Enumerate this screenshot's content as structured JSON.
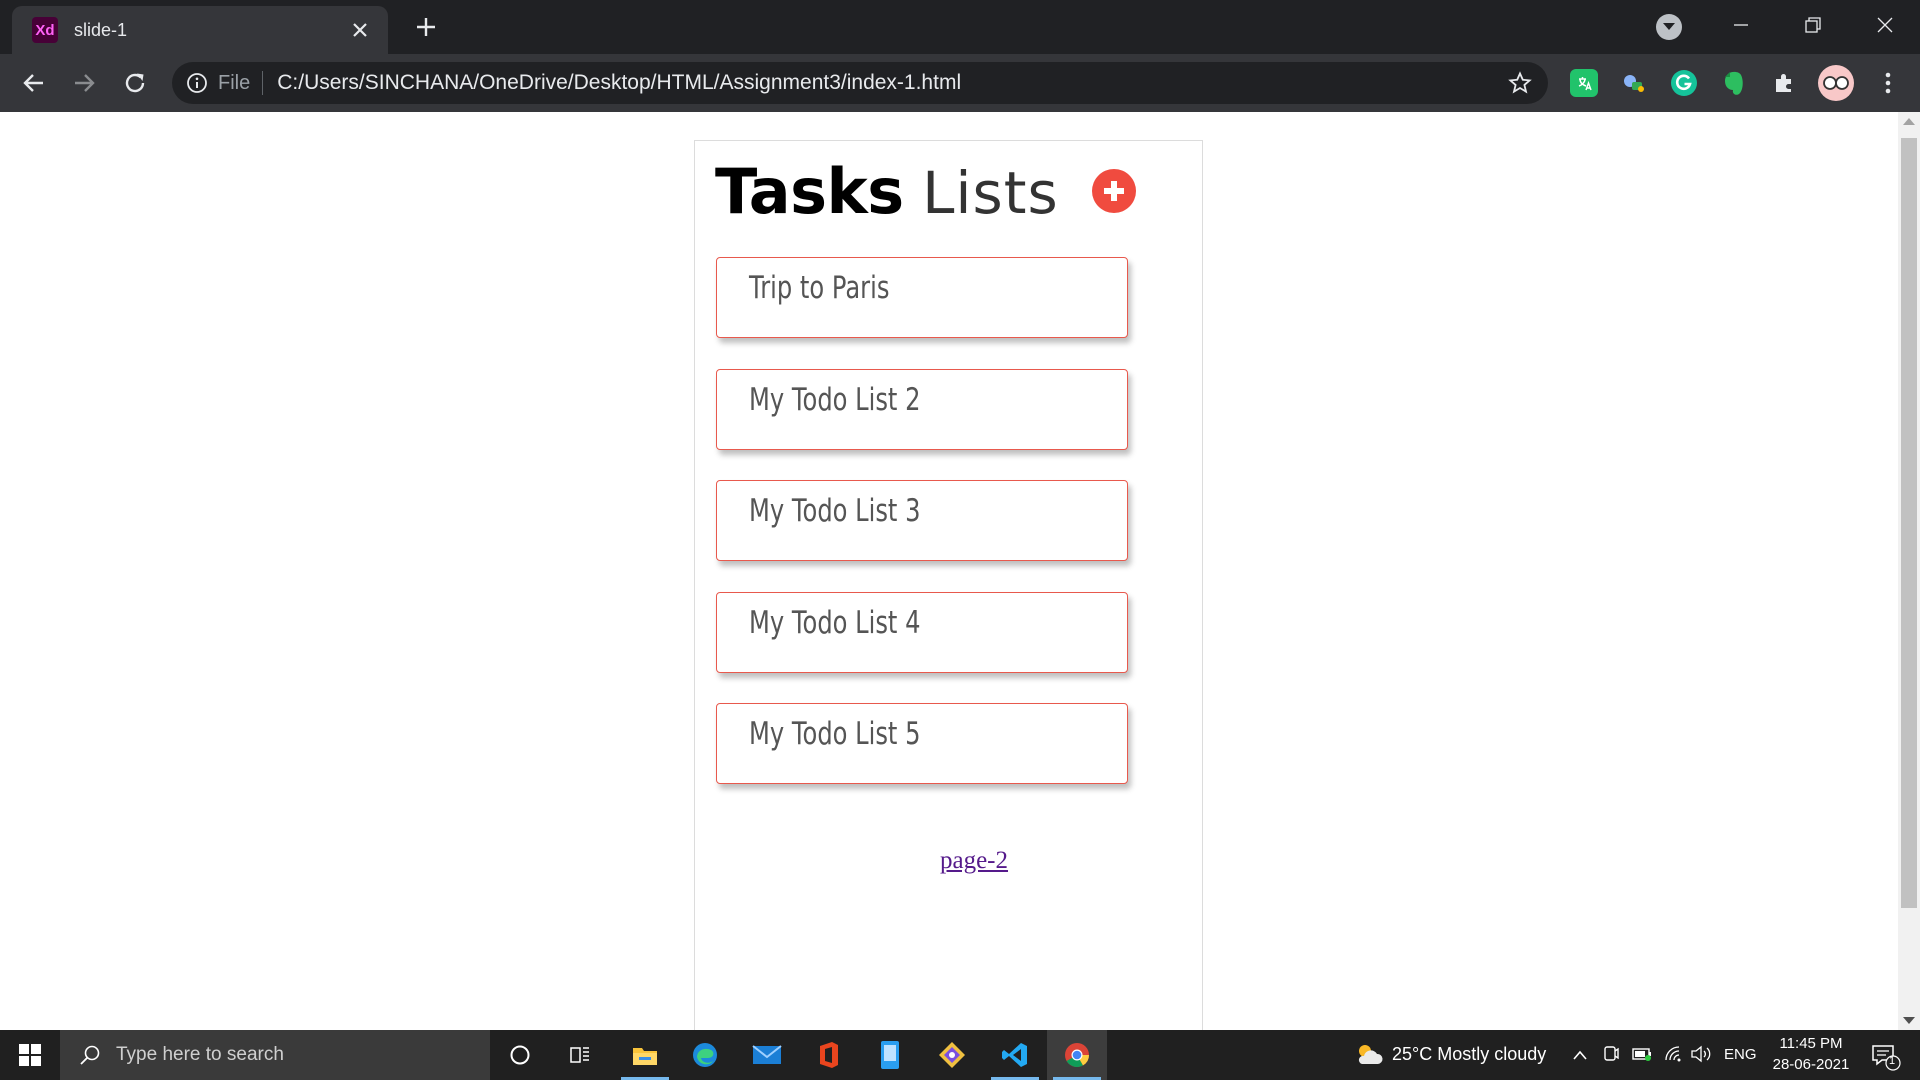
{
  "browser": {
    "tab": {
      "favicon_text": "Xd",
      "title": "slide-1"
    },
    "address": {
      "scheme_label": "File",
      "url": "C:/Users/SINCHANA/OneDrive/Desktop/HTML/Assignment3/index-1.html"
    }
  },
  "page": {
    "heading_strong": "Tasks",
    "heading_light": "Lists",
    "lists": [
      {
        "name": "Trip to Paris"
      },
      {
        "name": "My Todo List 2"
      },
      {
        "name": "My Todo List 3"
      },
      {
        "name": "My Todo List 4"
      },
      {
        "name": "My Todo List 5"
      }
    ],
    "link_label": "page-2",
    "accent_color": "#f04b3f"
  },
  "taskbar": {
    "search_placeholder": "Type here to search",
    "weather": "25°C  Mostly cloudy",
    "language": "ENG",
    "time": "11:45 PM",
    "date": "28-06-2021",
    "notification_count": "1"
  }
}
